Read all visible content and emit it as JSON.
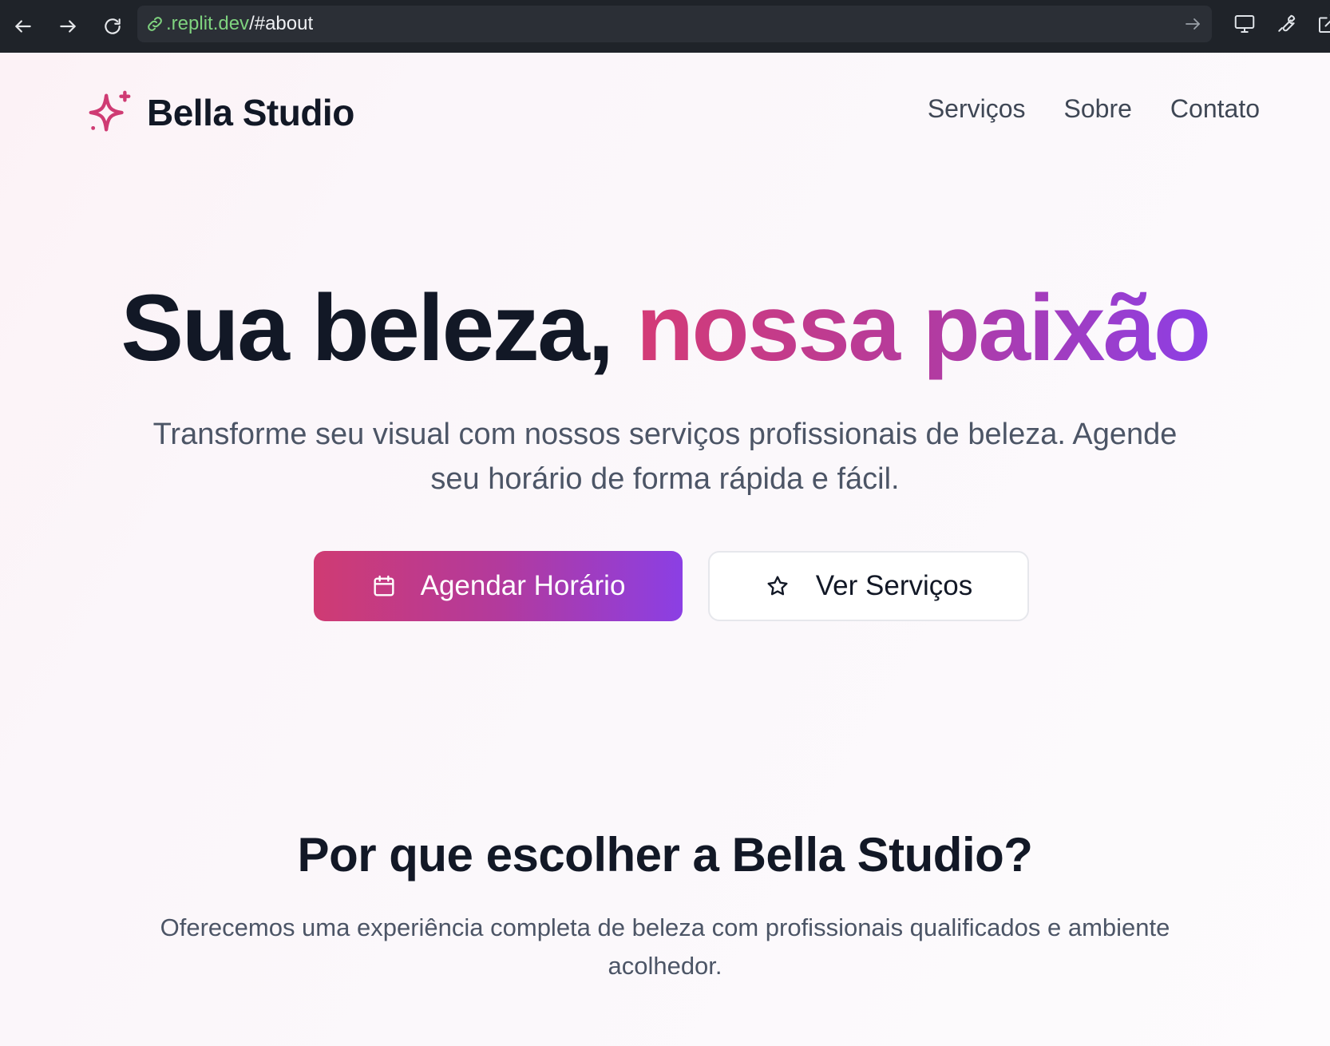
{
  "browser": {
    "url_host": ".replit.dev",
    "url_path": "/#about"
  },
  "header": {
    "brand_name": "Bella Studio",
    "brand_icon": "sparkles-icon",
    "nav": [
      "Serviços",
      "Sobre",
      "Contato"
    ]
  },
  "hero": {
    "title_plain": "Sua beleza, ",
    "title_highlight": "nossa paixão",
    "subtitle": "Transforme seu visual com nossos serviços profissionais de beleza. Agende seu horário de forma rápida e fácil.",
    "primary_button": "Agendar Horário",
    "primary_icon": "calendar-icon",
    "secondary_button": "Ver Serviços",
    "secondary_icon": "star-icon"
  },
  "why": {
    "title": "Por que escolher a Bella Studio?",
    "subtitle": "Oferecemos uma experiência completa de beleza com profissionais qualificados e ambiente acolhedor."
  },
  "colors": {
    "accent_start": "#d43b76",
    "accent_end": "#8c3fe6",
    "text_dark": "#121826",
    "text_muted": "#4c5566",
    "chrome_bg": "#1f2329"
  }
}
